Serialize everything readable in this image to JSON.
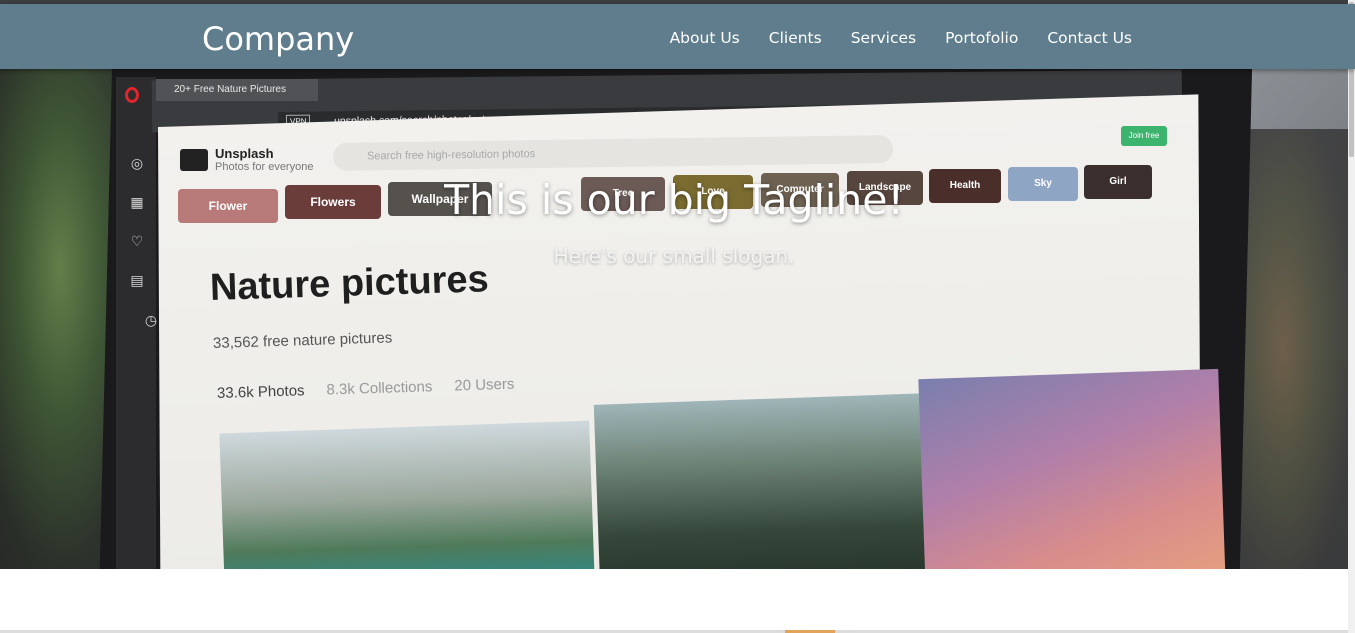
{
  "navbar": {
    "brand": "Company",
    "links": [
      "About Us",
      "Clients",
      "Services",
      "Portofolio",
      "Contact Us"
    ]
  },
  "hero": {
    "tagline": "This is our big Tagline!",
    "slogan": "Here's our small slogan.",
    "background_photo": {
      "browser_tab": "20+ Free Nature Pictures",
      "address": "unsplash.com/search/photos/nature",
      "vpn": "VPN",
      "site_name": "Unsplash",
      "site_sub": "Photos for everyone",
      "search_placeholder": "Search free high-resolution photos",
      "join_label": "Join free",
      "chips": [
        "Flower",
        "Flowers",
        "Wallpaper",
        "Tree",
        "Love",
        "Computer",
        "Landscape",
        "Health",
        "Sky",
        "Girl"
      ],
      "page_title": "Nature pictures",
      "count": "33,562 free nature pictures",
      "tabs": [
        "33.6k Photos",
        "8.3k Collections",
        "20 Users"
      ]
    }
  },
  "colors": {
    "navbar": "#5f7d8c",
    "text": "#ffffff",
    "join_button": "#3cb46e"
  }
}
